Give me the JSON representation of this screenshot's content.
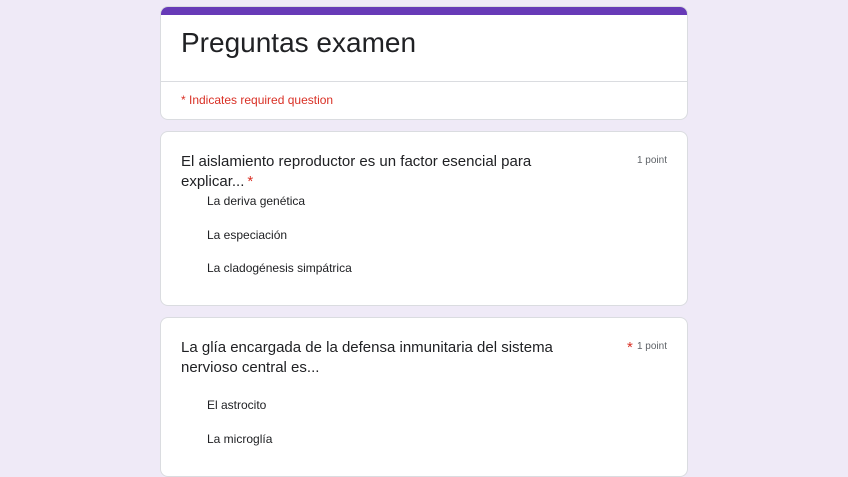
{
  "form": {
    "title": "Preguntas examen",
    "required_note": "* Indicates required question",
    "accent_color": "#673ab7",
    "background_color": "#efeaf7"
  },
  "questions": [
    {
      "title": "El aislamiento reproductor es un factor esencial para explicar...",
      "required_mark": "*",
      "points": "1 point",
      "options": [
        "La deriva genética",
        "La especiación",
        "La cladogénesis simpátrica"
      ]
    },
    {
      "title": "La glía encargada de la defensa inmunitaria del sistema nervioso central es...",
      "required_mark": "*",
      "points": "1 point",
      "options": [
        "El astrocito",
        "La microglía"
      ]
    }
  ]
}
